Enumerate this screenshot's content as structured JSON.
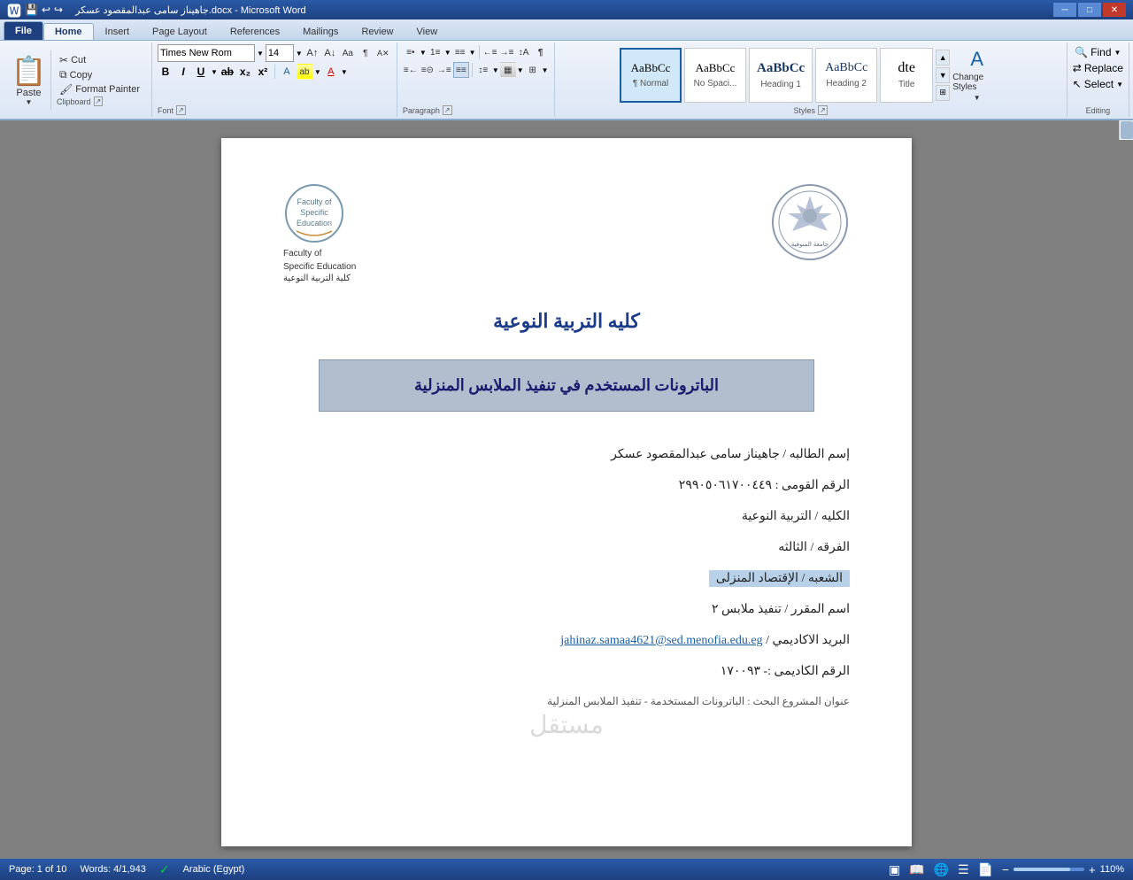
{
  "titlebar": {
    "title": "جاهيناز سامى عبدالمقصود عسكر.docx - Microsoft Word",
    "subtitle": "تنفيذ ملابس ٢"
  },
  "tabs": [
    "File",
    "Home",
    "Insert",
    "Page Layout",
    "References",
    "Mailings",
    "Review",
    "View"
  ],
  "activeTab": "Home",
  "ribbon": {
    "clipboard": {
      "paste": "Paste",
      "cut": "Cut",
      "copy": "Copy",
      "formatPainter": "Format Painter",
      "label": "Clipboard"
    },
    "font": {
      "fontName": "Times New Rom",
      "fontSize": "14",
      "label": "Font"
    },
    "paragraph": {
      "label": "Paragraph"
    },
    "styles": {
      "normal": "Normal",
      "noSpacing": "No Spaci...",
      "heading1": "Heading 1",
      "heading2": "Heading 2",
      "title": "Title",
      "changeStyles": "Change Styles",
      "label": "Styles"
    },
    "editing": {
      "find": "Find",
      "replace": "Replace",
      "select": "Select",
      "label": "Editing"
    }
  },
  "document": {
    "facultyEnglish": "Faculty of\nSpecific Education",
    "facultyArabic": "كلية التربية النوعية",
    "uniName": "كليه التربية النوعية",
    "mainTitle": "الباترونات المستخدم في تنفيذ الملابس المنزلية",
    "studentLabel": "إسم الطالبه / جاهيناز سامى عبدالمقصود عسكر",
    "nationalId": "الرقم القومى : ٢٩٩٠٥٠٦١٧٠٠٤٤٩",
    "college": "الكليه / التربية النوعية",
    "class": "الفرقه / الثالثه",
    "department": "الشعبه / الإقتصاد المنزلى",
    "course": "اسم المقرر / تنفيذ ملابس ٢",
    "email": "البريد الاكاديمي / jahinaz.samaa4621@sed.menofia.edu.eg",
    "academicId": "الرقم الكاديمى :- ١٧٠٠٩٣",
    "projectTitle": "عنوان المشروع البحث : الباترونات المستخدمة - تنفيذ الملابس المنزلية",
    "watermark": "مستقل"
  },
  "statusbar": {
    "page": "Page: 1 of 10",
    "words": "Words: 4/1,943",
    "language": "Arabic (Egypt)",
    "zoom": "110%"
  }
}
